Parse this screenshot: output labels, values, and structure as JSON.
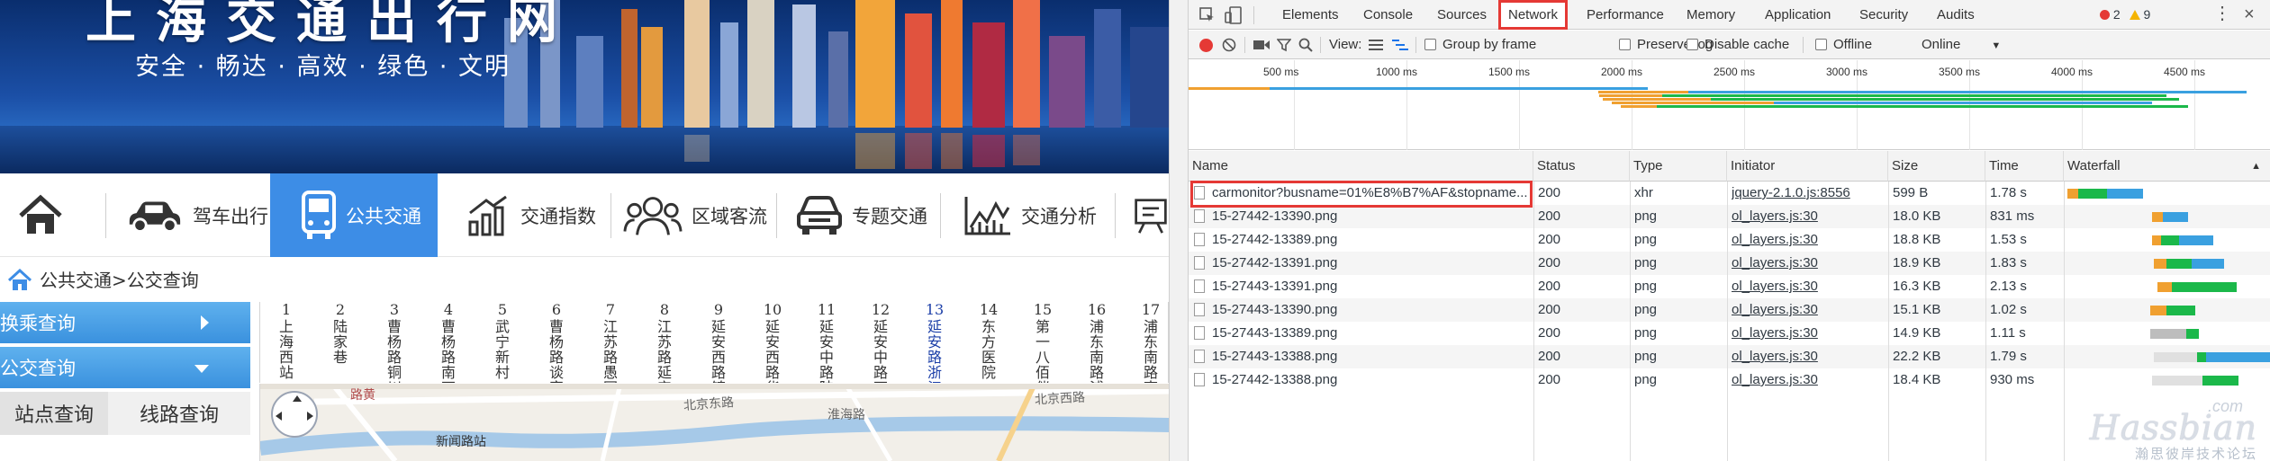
{
  "site": {
    "title": "上海交通出行网",
    "slogan": "安全 · 畅达 · 高效 · 绿色 · 文明",
    "nav": [
      {
        "label": "",
        "icon": "home-icon"
      },
      {
        "label": "驾车出行",
        "icon": "car-icon"
      },
      {
        "label": "公共交通",
        "icon": "bus-icon",
        "active": true
      },
      {
        "label": "交通指数",
        "icon": "chart-rise-icon"
      },
      {
        "label": "区域客流",
        "icon": "people-icon"
      },
      {
        "label": "专题交通",
        "icon": "car-front-icon"
      },
      {
        "label": "交通分析",
        "icon": "line-chart-icon"
      },
      {
        "label": "",
        "icon": "board-icon"
      }
    ],
    "breadcrumb": "公共交通>公交查询",
    "side_menu": {
      "transfer": "换乘查询",
      "bus": "公交查询",
      "tab_station": "站点查询",
      "tab_route": "线路查询"
    },
    "stops": [
      {
        "num": "1",
        "name": "上海西站"
      },
      {
        "num": "2",
        "name": "陆家巷"
      },
      {
        "num": "3",
        "name": "曹杨路铜川路"
      },
      {
        "num": "4",
        "name": "曹杨路南石路"
      },
      {
        "num": "5",
        "name": "武宁新村"
      },
      {
        "num": "6",
        "name": "曹杨路谈家渡路"
      },
      {
        "num": "7",
        "name": "江苏路愚园路"
      },
      {
        "num": "8",
        "name": "江苏路延安西路"
      },
      {
        "num": "9",
        "name": "延安西路镇宁路"
      },
      {
        "num": "10",
        "name": "延安西路华山路"
      },
      {
        "num": "11",
        "name": "延安中路陕西北路"
      },
      {
        "num": "12",
        "name": "延安中路石门一路"
      },
      {
        "num": "13",
        "name": "延安路浙江中路",
        "current": true
      },
      {
        "num": "14",
        "name": "东方医院"
      },
      {
        "num": "15",
        "name": "第一八佰伴"
      },
      {
        "num": "16",
        "name": "浦东南路浦电路"
      },
      {
        "num": "17",
        "name": "浦东南路南泉路"
      }
    ],
    "map_labels": [
      "北京东路",
      "新闻路站",
      "淮海路",
      "北京西路",
      "路黄"
    ]
  },
  "devtools": {
    "tabs": [
      "Elements",
      "Console",
      "Sources",
      "Network",
      "Performance",
      "Memory",
      "Application",
      "Security",
      "Audits"
    ],
    "active_tab": "Network",
    "errors": "2",
    "warnings": "9",
    "toolbar": {
      "view": "View:",
      "group_by_frame": "Group by frame",
      "preserve_log": "Preserve log",
      "disable_cache": "Disable cache",
      "offline": "Offline",
      "online": "Online"
    },
    "timeline_ticks": [
      "500 ms",
      "1000 ms",
      "1500 ms",
      "2000 ms",
      "2500 ms",
      "3000 ms",
      "3500 ms",
      "4000 ms",
      "4500 ms"
    ],
    "columns": [
      "Name",
      "Status",
      "Type",
      "Initiator",
      "Size",
      "Time",
      "Waterfall"
    ],
    "rows": [
      {
        "name": "carmonitor?busname=01%E8%B7%AF&stopname...",
        "status": "200",
        "type": "xhr",
        "initiator": "jquery-2.1.0.js:8556",
        "size": "599 B",
        "time": "1.78 s",
        "highlight": true
      },
      {
        "name": "15-27442-13390.png",
        "status": "200",
        "type": "png",
        "initiator": "ol_layers.js:30",
        "size": "18.0 KB",
        "time": "831 ms"
      },
      {
        "name": "15-27442-13389.png",
        "status": "200",
        "type": "png",
        "initiator": "ol_layers.js:30",
        "size": "18.8 KB",
        "time": "1.53 s"
      },
      {
        "name": "15-27442-13391.png",
        "status": "200",
        "type": "png",
        "initiator": "ol_layers.js:30",
        "size": "18.9 KB",
        "time": "1.83 s"
      },
      {
        "name": "15-27443-13391.png",
        "status": "200",
        "type": "png",
        "initiator": "ol_layers.js:30",
        "size": "16.3 KB",
        "time": "2.13 s"
      },
      {
        "name": "15-27443-13390.png",
        "status": "200",
        "type": "png",
        "initiator": "ol_layers.js:30",
        "size": "15.1 KB",
        "time": "1.02 s"
      },
      {
        "name": "15-27443-13389.png",
        "status": "200",
        "type": "png",
        "initiator": "ol_layers.js:30",
        "size": "14.9 KB",
        "time": "1.11 s"
      },
      {
        "name": "15-27443-13388.png",
        "status": "200",
        "type": "png",
        "initiator": "ol_layers.js:30",
        "size": "22.2 KB",
        "time": "1.79 s"
      },
      {
        "name": "15-27442-13388.png",
        "status": "200",
        "type": "png",
        "initiator": "ol_layers.js:30",
        "size": "18.4 KB",
        "time": "930 ms"
      }
    ],
    "watermark": {
      "brand": "Hassbian",
      "suffix": ".com",
      "sub": "瀚思彼岸技术论坛"
    }
  }
}
